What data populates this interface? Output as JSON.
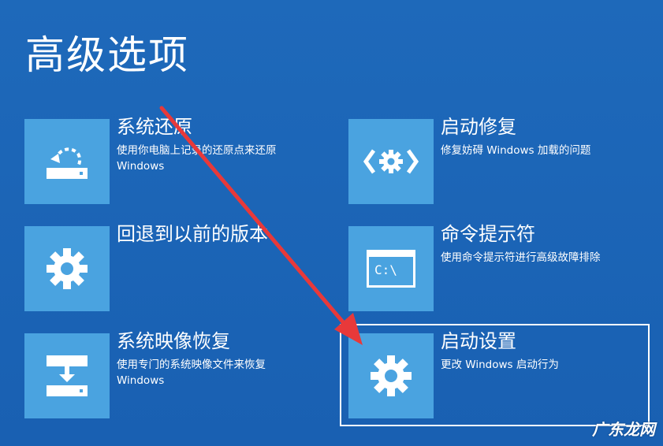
{
  "page": {
    "title": "高级选项"
  },
  "options": [
    {
      "title": "系统还原",
      "description": "使用你电脑上记录的还原点来还原\nWindows",
      "icon": "system-restore-icon"
    },
    {
      "title": "启动修复",
      "description": "修复妨碍 Windows 加载的问题",
      "icon": "startup-repair-icon"
    },
    {
      "title": "回退到以前的版本",
      "description": "",
      "icon": "gear-icon"
    },
    {
      "title": "命令提示符",
      "description": "使用命令提示符进行高级故障排除",
      "icon": "command-prompt-icon",
      "icon_text": "C:\\"
    },
    {
      "title": "系统映像恢复",
      "description": "使用专门的系统映像文件来恢复\nWindows",
      "icon": "system-image-recovery-icon"
    },
    {
      "title": "启动设置",
      "description": "更改 Windows 启动行为",
      "icon": "gear-icon",
      "selected": true
    }
  ],
  "annotation": {
    "arrow_color": "#e8393a"
  },
  "watermark": {
    "text": "广东龙网"
  },
  "colors": {
    "background": "#1b64b6",
    "tile": "#4aa3e0",
    "text": "#ffffff"
  }
}
